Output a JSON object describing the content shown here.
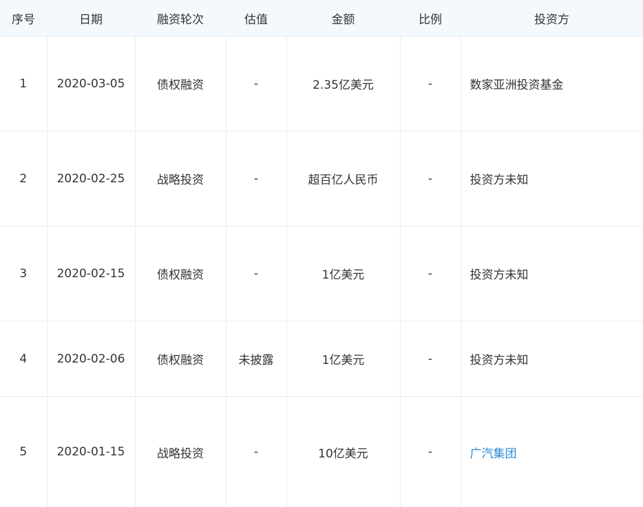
{
  "table": {
    "headers": [
      "序号",
      "日期",
      "融资轮次",
      "估值",
      "金额",
      "比例",
      "投资方"
    ],
    "rows": [
      {
        "index": "1",
        "date": "2020-03-05",
        "round": "债权融资",
        "valuation": "-",
        "amount": "2.35亿美元",
        "ratio": "-",
        "investor": "数家亚洲投资基金",
        "investor_is_link": false
      },
      {
        "index": "2",
        "date": "2020-02-25",
        "round": "战略投资",
        "valuation": "-",
        "amount": "超百亿人民币",
        "ratio": "-",
        "investor": "投资方未知",
        "investor_is_link": false
      },
      {
        "index": "3",
        "date": "2020-02-15",
        "round": "债权融资",
        "valuation": "-",
        "amount": "1亿美元",
        "ratio": "-",
        "investor": "投资方未知",
        "investor_is_link": false
      },
      {
        "index": "4",
        "date": "2020-02-06",
        "round": "债权融资",
        "valuation": "未披露",
        "amount": "1亿美元",
        "ratio": "-",
        "investor": "投资方未知",
        "investor_is_link": false
      },
      {
        "index": "5",
        "date": "2020-01-15",
        "round": "战略投资",
        "valuation": "-",
        "amount": "10亿美元",
        "ratio": "-",
        "investor": "广汽集团",
        "investor_is_link": true
      }
    ]
  },
  "colors": {
    "header_bg": "#f3f9fd",
    "text": "#333333",
    "link": "#2a8ad8",
    "border": "#e9edf0"
  }
}
